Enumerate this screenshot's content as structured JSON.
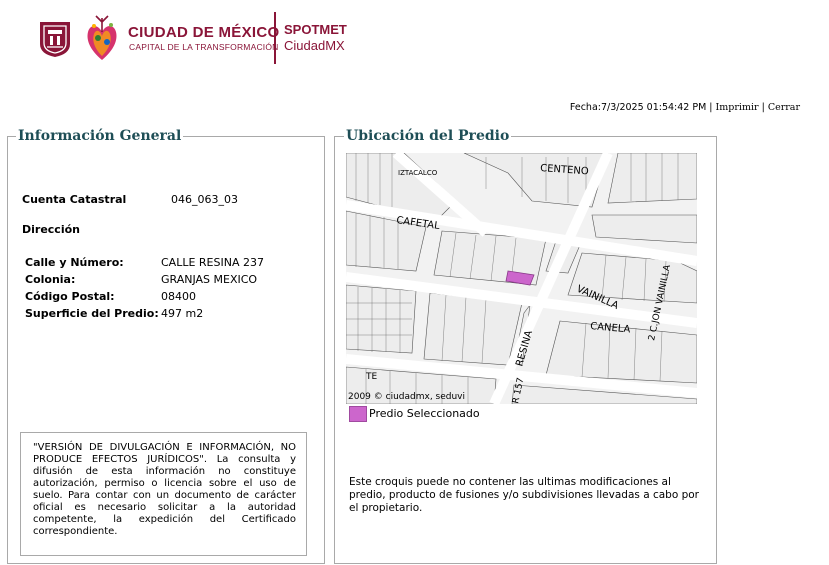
{
  "header": {
    "brand_title": "CIUDAD DE MÉXICO",
    "brand_subtitle": "CAPITAL DE LA TRANSFORMACIÓN",
    "app_name_line1": "SPOTMET",
    "app_name_line2": "CiudadMX",
    "accent_color": "#8a1538"
  },
  "meta": {
    "fecha": "Fecha:7/3/2025 01:54:42 PM",
    "separator": "|",
    "print_label": "Imprimir",
    "close_label": "Cerrar"
  },
  "info": {
    "legend": "Información General",
    "cuenta_label": "Cuenta Catastral",
    "cuenta_value": "046_063_03",
    "direccion_label": "Dirección",
    "calle_label": "Calle y Número:",
    "calle_value": "CALLE RESINA 237",
    "colonia_label": "Colonia:",
    "colonia_value": "GRANJAS MEXICO",
    "cp_label": "Código Postal:",
    "cp_value": "08400",
    "superficie_label": "Superficie del Predio:",
    "superficie_value": "497 m2",
    "disclaimer": "\"VERSIÓN DE DIVULGACIÓN E INFORMACIÓN, NO PRODUCE EFECTOS JURÍDICOS\". La consulta y difusión de esta información no constituye autorización, permiso o licencia sobre el uso de suelo. Para contar con un documento de carácter oficial es necesario solicitar a la autoridad competente, la expedición del Certificado correspondiente."
  },
  "location": {
    "legend": "Ubicación del Predio",
    "map_labels": {
      "centeno": "CENTENO",
      "iztacalco": "IZTACALCO",
      "cafetal": "CAFETAL",
      "vainilla": "VAINILLA",
      "vainilla2": "2 C.JON VAINILLA",
      "canela": "CANELA",
      "resina": "RESINA",
      "r157": "R 157",
      "te": "TE",
      "copyright": "2009 © ciudadmx, seduvi"
    },
    "legend_item": "Predio Seleccionado",
    "selected_color": "#cc66cc",
    "note": "Este croquis puede no contener las ultimas modificaciones al predio, producto de fusiones y/o subdivisiones llevadas a cabo por el propietario."
  }
}
